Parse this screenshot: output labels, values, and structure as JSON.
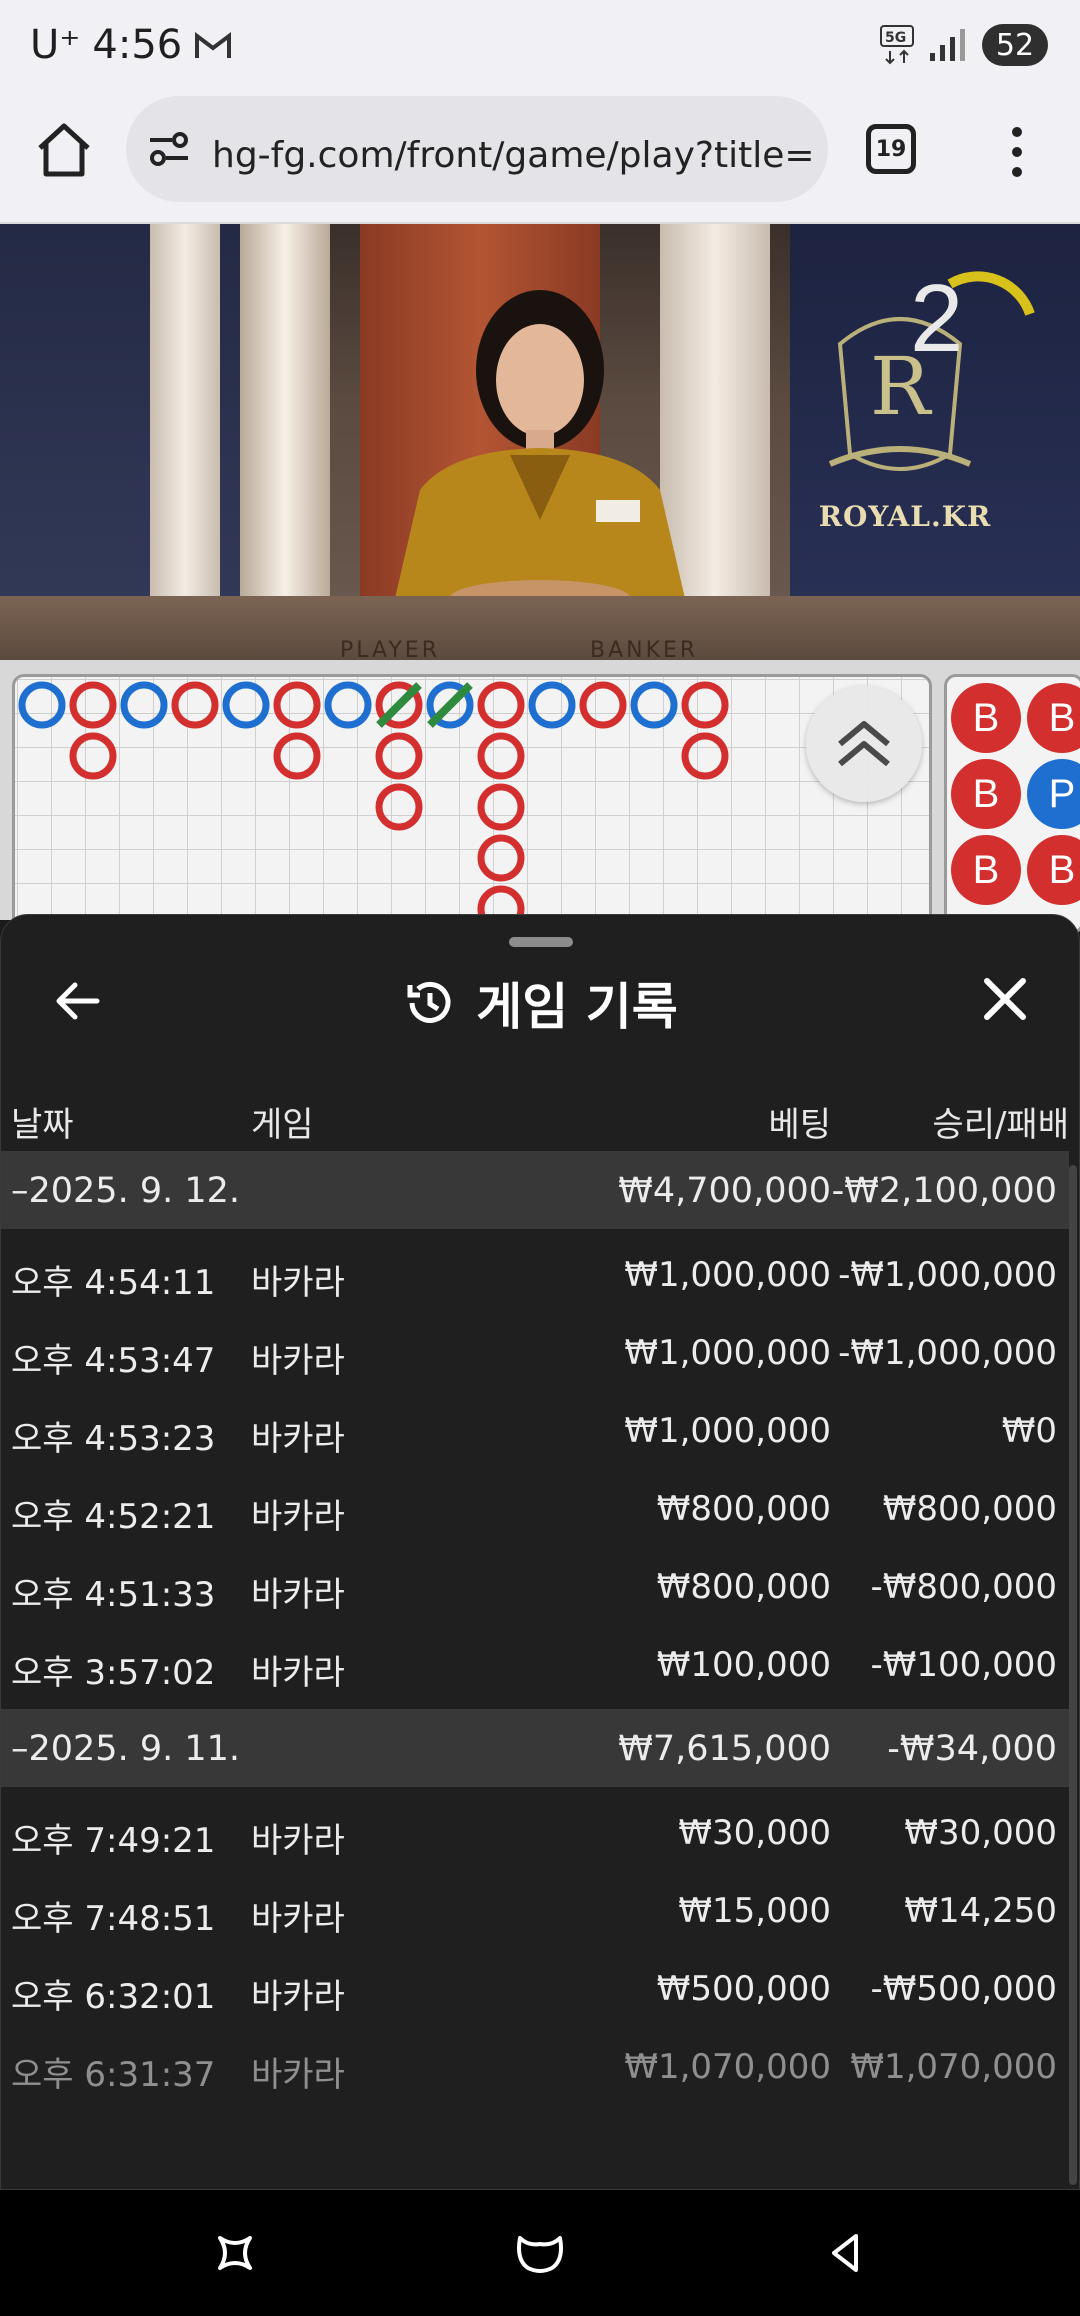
{
  "status_bar": {
    "carrier": "U⁺",
    "time": "4:56",
    "network": "5G",
    "battery": "52"
  },
  "browser": {
    "url": "hg-fg.com/front/game/play?title=에볼루",
    "tab_count": "19"
  },
  "video": {
    "countdown": "2",
    "brand": "ROYAL.KR",
    "table_left_label": "PLAYER",
    "table_right_label": "BANKER"
  },
  "bead_plate": [
    {
      "label": "B",
      "type": "banker"
    },
    {
      "label": "B",
      "type": "banker"
    },
    {
      "label": "B",
      "type": "banker"
    },
    {
      "label": "P",
      "type": "player"
    },
    {
      "label": "B",
      "type": "banker"
    },
    {
      "label": "B",
      "type": "banker"
    }
  ],
  "history": {
    "title": "게임 기록",
    "columns": {
      "date": "날짜",
      "game": "게임",
      "bet": "베팅",
      "result": "승리/패배"
    },
    "groups": [
      {
        "date": "–2025. 9. 12.",
        "bet_total": "₩4,700,000",
        "result_total": "-₩2,100,000",
        "rows": [
          {
            "time": "오후 4:54:11",
            "game": "바카라",
            "bet": "₩1,000,000",
            "result": "-₩1,000,000"
          },
          {
            "time": "오후 4:53:47",
            "game": "바카라",
            "bet": "₩1,000,000",
            "result": "-₩1,000,000"
          },
          {
            "time": "오후 4:53:23",
            "game": "바카라",
            "bet": "₩1,000,000",
            "result": "₩0"
          },
          {
            "time": "오후 4:52:21",
            "game": "바카라",
            "bet": "₩800,000",
            "result": "₩800,000"
          },
          {
            "time": "오후 4:51:33",
            "game": "바카라",
            "bet": "₩800,000",
            "result": "-₩800,000"
          },
          {
            "time": "오후 3:57:02",
            "game": "바카라",
            "bet": "₩100,000",
            "result": "-₩100,000"
          }
        ]
      },
      {
        "date": "–2025. 9. 11.",
        "bet_total": "₩7,615,000",
        "result_total": "-₩34,000",
        "rows": [
          {
            "time": "오후 7:49:21",
            "game": "바카라",
            "bet": "₩30,000",
            "result": "₩30,000"
          },
          {
            "time": "오후 7:48:51",
            "game": "바카라",
            "bet": "₩15,000",
            "result": "₩14,250"
          },
          {
            "time": "오후 6:32:01",
            "game": "바카라",
            "bet": "₩500,000",
            "result": "-₩500,000"
          },
          {
            "time": "오후 6:31:37",
            "game": "바카라",
            "bet": "₩1,070,000",
            "result": "₩1,070,000"
          }
        ]
      }
    ]
  },
  "colors": {
    "banker": "#d32f2f",
    "player": "#1e6fd0",
    "tie": "#2e8b3e",
    "sheet_bg": "#1f1f1f",
    "group_bg": "#383838"
  }
}
